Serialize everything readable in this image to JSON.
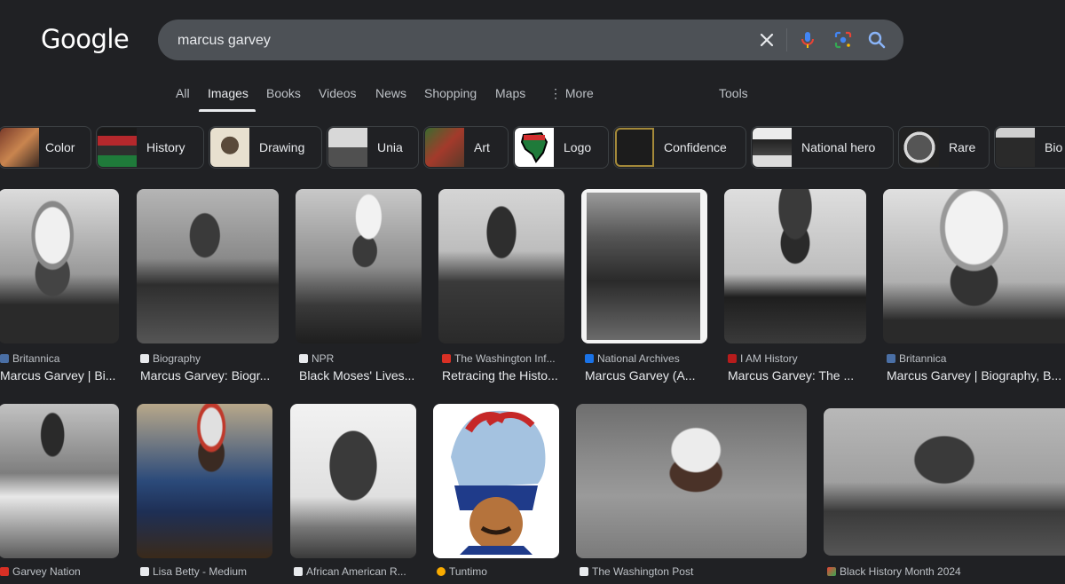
{
  "logo": "Google",
  "search": {
    "value": "marcus garvey"
  },
  "tabs": [
    "All",
    "Images",
    "Books",
    "Videos",
    "News",
    "Shopping",
    "Maps",
    "⋮ More"
  ],
  "tools": "Tools",
  "chips": [
    "Color",
    "History",
    "Drawing",
    "Unia",
    "Art",
    "Logo",
    "Confidence",
    "National hero",
    "Rare",
    "Bio"
  ],
  "results_row1": [
    {
      "source": "Britannica",
      "title": "Marcus Garvey | Bi..."
    },
    {
      "source": "Biography",
      "title": "Marcus Garvey: Biogr..."
    },
    {
      "source": "NPR",
      "title": "Black Moses' Lives..."
    },
    {
      "source": "The Washington Inf...",
      "title": "Retracing the Histo..."
    },
    {
      "source": "National Archives",
      "title": "Marcus Garvey (A..."
    },
    {
      "source": "I AM History",
      "title": "Marcus Garvey: The ..."
    },
    {
      "source": "Britannica",
      "title": "Marcus Garvey | Biography, B..."
    }
  ],
  "results_row2": [
    {
      "source": "Garvey Nation"
    },
    {
      "source": "Lisa Betty - Medium"
    },
    {
      "source": "African American R..."
    },
    {
      "source": "Tuntimo"
    },
    {
      "source": "The Washington Post"
    },
    {
      "source": "Black History Month 2024"
    }
  ],
  "colors": {
    "background": "#202124",
    "searchbox": "#4d5156",
    "text": "#e8eaed",
    "muted": "#bdc1c6"
  },
  "icons": [
    "clear-icon",
    "microphone-icon",
    "lens-icon",
    "search-icon"
  ]
}
